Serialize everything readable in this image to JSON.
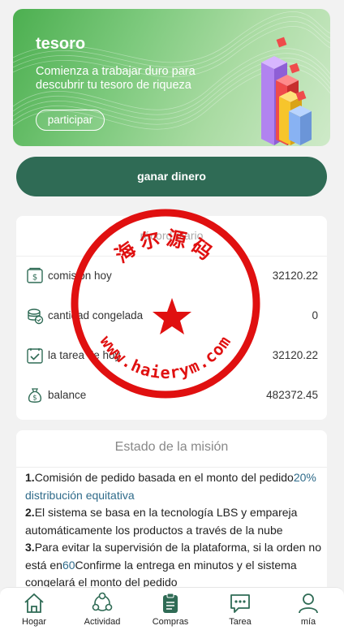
{
  "banner": {
    "title": "tesoro",
    "description": "Comienza a trabajar duro para descubrir tu tesoro de riqueza",
    "button_label": "participar"
  },
  "main_button": {
    "label": "ganar dinero"
  },
  "record": {
    "title": "récord diario",
    "rows": [
      {
        "icon": "invoice-icon",
        "label": "comisión hoy",
        "value": "32120.22"
      },
      {
        "icon": "coins-icon",
        "label": "cantidad congelada",
        "value": "0"
      },
      {
        "icon": "checklist-icon",
        "label": "la tarea de hoy",
        "value": "32120.22"
      },
      {
        "icon": "money-bag-icon",
        "label": "balance",
        "value": "482372.45"
      }
    ]
  },
  "mission": {
    "title": "Estado de la misión",
    "items": [
      {
        "num": "1.",
        "text_before": "Comisión de pedido basada en el monto del pedido",
        "highlight": "20% distribución equitativa",
        "text_after": ""
      },
      {
        "num": "2.",
        "text_before": "El sistema se basa en la tecnología LBS y empareja automáticamente los productos a través de la nube",
        "highlight": "",
        "text_after": ""
      },
      {
        "num": "3.",
        "text_before": "Para evitar la supervisión de la plataforma, si la orden no está en",
        "highlight": "60",
        "text_after": "Confirme la entrega en minutos y el sistema congelará el monto del pedido"
      }
    ]
  },
  "watermark": {
    "top_text": "海尔源码",
    "bottom_text": "www.haierym.com",
    "color": "#e01010"
  },
  "tabs": [
    {
      "icon": "home-icon",
      "label": "Hogar"
    },
    {
      "icon": "activity-icon",
      "label": "Actividad"
    },
    {
      "icon": "clipboard-icon",
      "label": "Compras"
    },
    {
      "icon": "chat-icon",
      "label": "Tarea"
    },
    {
      "icon": "user-icon",
      "label": "mía"
    }
  ],
  "colors": {
    "primary": "#2f6b55",
    "banner_green": "#4caf50",
    "highlight": "#2f6b8a"
  }
}
